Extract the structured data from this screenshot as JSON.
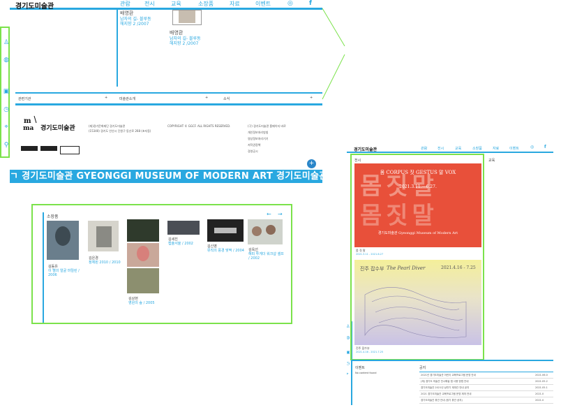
{
  "site": {
    "logo": "경기도미술관",
    "nav": [
      "관람",
      "전시",
      "교육",
      "소장품",
      "자료",
      "이벤트"
    ],
    "nav_icons": [
      "instagram-icon",
      "facebook-icon"
    ]
  },
  "panel_a": {
    "artworks": [
      {
        "artist": "배영환",
        "title": "남자의 길- 블루동",
        "year": "헤지향 2 /2007"
      },
      {
        "artist": "배영환",
        "title": "남자의 길- 블루동",
        "year": "헤지향 2 /2007"
      }
    ],
    "link_bar": [
      "관련기관",
      "미술관소개",
      "소식"
    ],
    "footer": {
      "logo_text": "경기도미술관",
      "address_lines": [
        "(재)경기문화재단 경기도미술관",
        "(15340) 경기도 안산시 단원구 동산로 268 (초지동)"
      ],
      "copyright": "COPYRIGHT © GGCF. ALL RIGHTS RESERVED.",
      "policy_links": [
        "(구) 경기도미술관 홈페이지 바로",
        "개인정보처리방침",
        "영상정보처리기기",
        "저작권정책",
        "경영공시"
      ]
    },
    "marquee": "ㄱ 경기도미술관 GYEONGGI MUSEUM OF MODERN ART 경기도미술관 GYEO",
    "plus_label": "+"
  },
  "panel_b": {
    "heading": "소장품",
    "items": [
      {
        "artist": "김동유",
        "title": "이 별의 얼굴 마릴린 /",
        "year": "2006"
      },
      {
        "artist": "김은경",
        "title": "정체된 2010 / 2010",
        "year": ""
      },
      {
        "artist": "김상현",
        "title": "영원의 숲 / 2005",
        "year": ""
      },
      {
        "artist": "김세진",
        "title": "캡슐서울 / 2002",
        "year": ""
      },
      {
        "artist": "김신영",
        "title": "뮤직의 풍경 맞짝 / 2004",
        "year": ""
      },
      {
        "artist": "김옥선",
        "title": "해피 투게더 워크샵 셀프",
        "year": "/ 2002"
      }
    ]
  },
  "panel_c": {
    "logo": "경기도미술관",
    "nav": [
      "관람",
      "전시",
      "교육",
      "소장품",
      "자료",
      "이벤트"
    ],
    "section_exhibit": "전시",
    "section_edu": "교육",
    "poster1": {
      "title": "몸 CORPUS 짓 GESTUS 말 VOX",
      "dates": "2021.3.11.—6.27.",
      "museum": "경기도미술관 Gyeonggi Museum of Modern Art",
      "big": "몸짓말",
      "caption": "몸 짓 말",
      "caption_dates": "2021.3.11 - 2021.6.27"
    },
    "poster2": {
      "title": "진주 잡수부",
      "title_en": "The Pearl Diver",
      "dates": "2021.4.16 - 7.25",
      "caption": "진주 잡수부",
      "caption_dates": "2021.4.16 - 2021.7.25"
    },
    "event_heading": "이벤트",
    "event_empty": "No content found",
    "notice_heading": "공지",
    "notices": [
      {
        "text": "2021년 경기도미술관 어린이 교육프로그램 운영 안내",
        "date": "2021.06.0"
      },
      {
        "text": "(재) 경기도 미술관 전시해설 앱 사용 방법 안내",
        "date": "2021.05.2"
      },
      {
        "text": "경기도미술관 2021년 상반기 재개관 안내 공지",
        "date": "2021.05.1"
      },
      {
        "text": "2021 경기도미술관 교육프로그램 운영 재개 안내",
        "date": "2021.0"
      },
      {
        "text": "경기도미술관 휴관 안내 (정기 휴관 공지)",
        "date": "2021.0"
      }
    ]
  },
  "colors": {
    "accent": "#29a8e0",
    "highlight": "#7be24b",
    "poster1": "#e8503a",
    "poster2": "#c9c2e6"
  }
}
